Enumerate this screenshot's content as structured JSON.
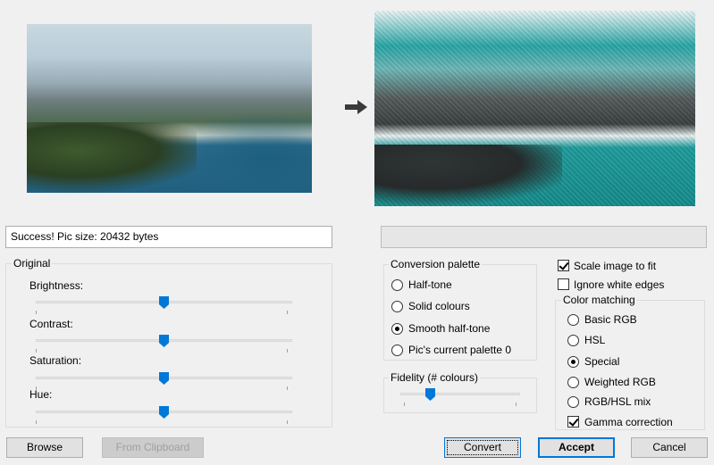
{
  "status": {
    "message": "Success! Pic size: 20432 bytes"
  },
  "original_group": {
    "title": "Original",
    "brightness": {
      "label": "Brightness:",
      "value": 0.5
    },
    "contrast": {
      "label": "Contrast:",
      "value": 0.5
    },
    "saturation": {
      "label": "Saturation:",
      "value": 0.5
    },
    "hue": {
      "label": "Hue:",
      "value": 0.5
    }
  },
  "palette_group": {
    "title": "Conversion palette",
    "options": [
      "Half-tone",
      "Solid colours",
      "Smooth half-tone",
      "Pic's current palette 0"
    ],
    "selected": "Smooth half-tone"
  },
  "fidelity_group": {
    "title": "Fidelity (# colours)",
    "value": 0.25
  },
  "options": {
    "scale_to_fit": {
      "label": "Scale image to fit",
      "checked": true
    },
    "ignore_white": {
      "label": "Ignore white edges",
      "checked": false
    }
  },
  "color_matching": {
    "title": "Color matching",
    "options": [
      "Basic RGB",
      "HSL",
      "Special",
      "Weighted RGB",
      "RGB/HSL mix"
    ],
    "selected": "Special",
    "gamma": {
      "label": "Gamma correction",
      "checked": true
    }
  },
  "buttons": {
    "browse": "Browse",
    "from_clipboard": "From Clipboard",
    "convert": "Convert",
    "accept": "Accept",
    "cancel": "Cancel"
  },
  "icons": {
    "arrow": "arrow-right-icon"
  },
  "colors": {
    "accent": "#0078d7",
    "background": "#f0f0f0"
  }
}
